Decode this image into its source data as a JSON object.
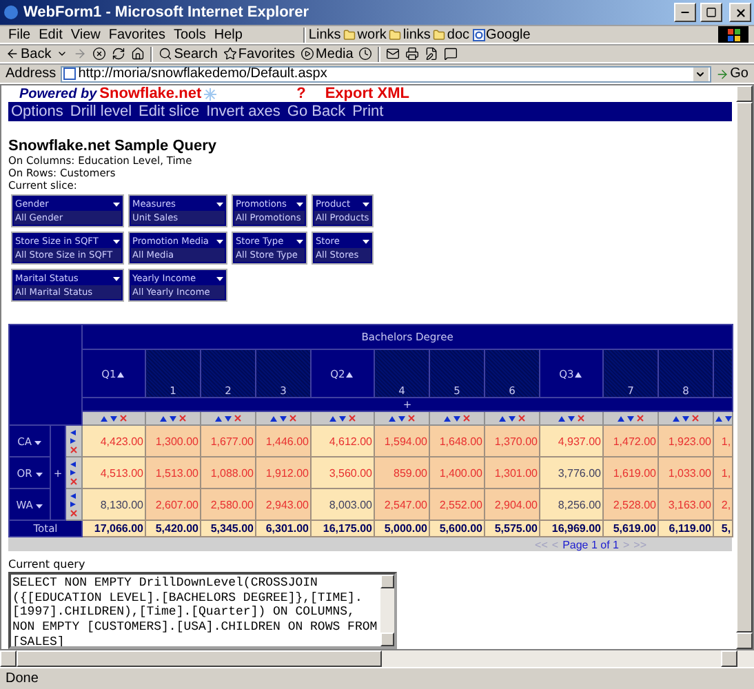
{
  "window": {
    "title": "WebForm1 - Microsoft Internet Explorer"
  },
  "menu": [
    "File",
    "Edit",
    "View",
    "Favorites",
    "Tools",
    "Help"
  ],
  "links": {
    "label": "Links",
    "items": [
      {
        "label": "work",
        "kind": "folder"
      },
      {
        "label": "links",
        "kind": "folder"
      },
      {
        "label": "doc",
        "kind": "folder"
      },
      {
        "label": "Google",
        "kind": "site"
      }
    ]
  },
  "toolbar": {
    "back": "Back",
    "search": "Search",
    "favorites": "Favorites",
    "media": "Media"
  },
  "address": {
    "label": "Address",
    "value": "http://moria/snowflakedemo/Default.aspx",
    "go": "Go"
  },
  "page": {
    "powered_by": "Powered by",
    "brand": "Snowflake.net",
    "help": "?",
    "export": "Export XML",
    "nav": [
      "Options",
      "Drill level",
      "Edit slice",
      "Invert axes",
      "Go Back",
      "Print"
    ],
    "heading": "Snowflake.net Sample Query",
    "info": [
      "On Columns: Education Level, Time",
      "On Rows: Customers",
      "Current slice:"
    ],
    "slicers": [
      [
        {
          "name": "Gender",
          "value": "All Gender"
        },
        {
          "name": "Measures",
          "value": "Unit Sales"
        },
        {
          "name": "Promotions",
          "value": "All Promotions"
        },
        {
          "name": "Product",
          "value": "All Products"
        }
      ],
      [
        {
          "name": "Store Size in SQFT",
          "value": "All Store Size in SQFT"
        },
        {
          "name": "Promotion Media",
          "value": "All Media"
        },
        {
          "name": "Store Type",
          "value": "All Store Type"
        },
        {
          "name": "Store",
          "value": "All Stores"
        }
      ],
      [
        {
          "name": "Marital Status",
          "value": "All Marital Status"
        },
        {
          "name": "Yearly Income",
          "value": "All Yearly Income"
        }
      ]
    ]
  },
  "pivot": {
    "column_group": "Bachelors Degree",
    "column_expand": "+",
    "row_expand": "+",
    "columns": [
      {
        "label": "Q1",
        "kind": "quarter"
      },
      {
        "label": "1",
        "kind": "month"
      },
      {
        "label": "2",
        "kind": "month"
      },
      {
        "label": "3",
        "kind": "month"
      },
      {
        "label": "Q2",
        "kind": "quarter"
      },
      {
        "label": "4",
        "kind": "month"
      },
      {
        "label": "5",
        "kind": "month"
      },
      {
        "label": "6",
        "kind": "month"
      },
      {
        "label": "Q3",
        "kind": "quarter"
      },
      {
        "label": "7",
        "kind": "month"
      },
      {
        "label": "8",
        "kind": "month"
      },
      {
        "kind": "month"
      }
    ],
    "rows": [
      {
        "label": "CA",
        "cells": [
          {
            "value": "4,423.00",
            "flagged": true
          },
          {
            "value": "1,300.00",
            "flagged": true
          },
          {
            "value": "1,677.00",
            "flagged": true
          },
          {
            "value": "1,446.00",
            "flagged": true
          },
          {
            "value": "4,612.00",
            "flagged": true
          },
          {
            "value": "1,594.00",
            "flagged": true
          },
          {
            "value": "1,648.00",
            "flagged": true
          },
          {
            "value": "1,370.00",
            "flagged": true
          },
          {
            "value": "4,937.00",
            "flagged": true
          },
          {
            "value": "1,472.00",
            "flagged": true
          },
          {
            "value": "1,923.00",
            "flagged": true
          },
          {
            "value": "1,",
            "flagged": true
          }
        ]
      },
      {
        "label": "OR",
        "cells": [
          {
            "value": "4,513.00",
            "flagged": true
          },
          {
            "value": "1,513.00",
            "flagged": true
          },
          {
            "value": "1,088.00",
            "flagged": true
          },
          {
            "value": "1,912.00",
            "flagged": true
          },
          {
            "value": "3,560.00",
            "flagged": true
          },
          {
            "value": "859.00",
            "flagged": true
          },
          {
            "value": "1,400.00",
            "flagged": true
          },
          {
            "value": "1,301.00",
            "flagged": true
          },
          {
            "value": "3,776.00",
            "flagged": false
          },
          {
            "value": "1,619.00",
            "flagged": true
          },
          {
            "value": "1,033.00",
            "flagged": true
          },
          {
            "value": "1,",
            "flagged": true
          }
        ]
      },
      {
        "label": "WA",
        "cells": [
          {
            "value": "8,130.00",
            "flagged": false
          },
          {
            "value": "2,607.00",
            "flagged": true
          },
          {
            "value": "2,580.00",
            "flagged": true
          },
          {
            "value": "2,943.00",
            "flagged": true
          },
          {
            "value": "8,003.00",
            "flagged": false
          },
          {
            "value": "2,547.00",
            "flagged": true
          },
          {
            "value": "2,552.00",
            "flagged": true
          },
          {
            "value": "2,904.00",
            "flagged": true
          },
          {
            "value": "8,256.00",
            "flagged": false
          },
          {
            "value": "2,528.00",
            "flagged": true
          },
          {
            "value": "3,163.00",
            "flagged": true
          },
          {
            "value": "2,",
            "flagged": true
          }
        ]
      }
    ],
    "total": {
      "label": "Total",
      "cells": [
        "17,066.00",
        "5,420.00",
        "5,345.00",
        "6,301.00",
        "16,175.00",
        "5,000.00",
        "5,600.00",
        "5,575.00",
        "16,969.00",
        "5,619.00",
        "6,119.00",
        "5,"
      ]
    },
    "pager": {
      "first": "<<",
      "prev": "<",
      "text": "Page 1 of 1",
      "next": ">",
      "last": ">>"
    }
  },
  "query": {
    "label": "Current query",
    "text": "SELECT NON EMPTY DrillDownLevel(CROSSJOIN ({[EDUCATION LEVEL].[BACHELORS DEGREE]},[TIME].[1997].CHILDREN),[Time].[Quarter]) ON COLUMNS, NON EMPTY [CUSTOMERS].[USA].CHILDREN ON ROWS FROM [SALES]"
  },
  "status_bar": {
    "text": "Done"
  }
}
